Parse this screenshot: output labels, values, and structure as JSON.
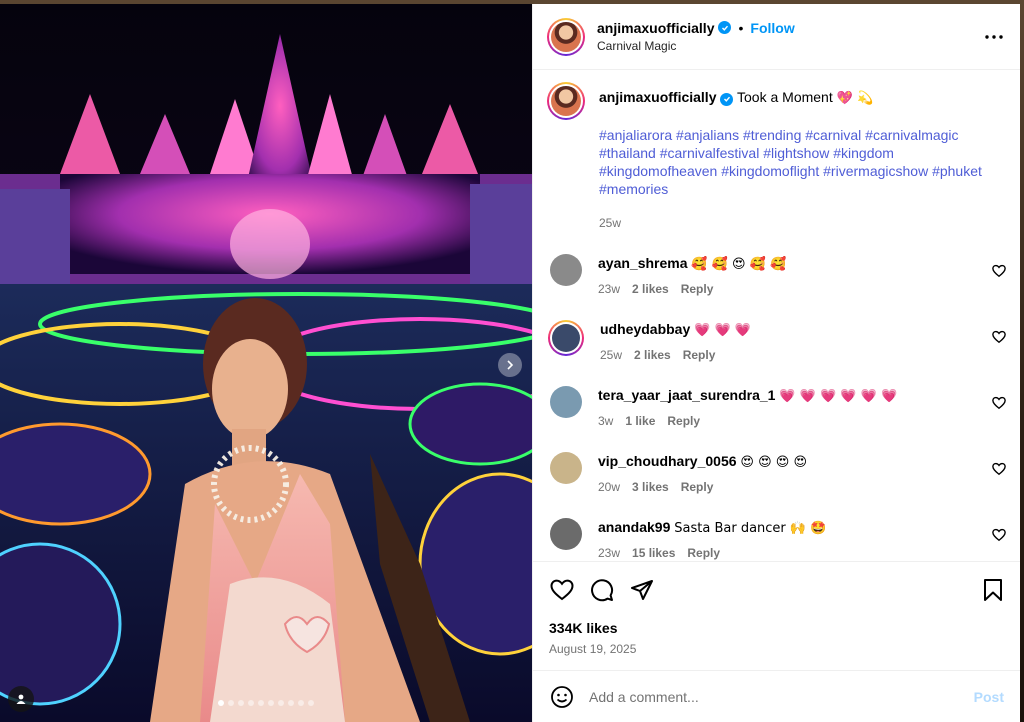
{
  "post": {
    "username": "anjimaxuofficially",
    "verified": true,
    "follow_label": "Follow",
    "separator": "•",
    "location": "Carnival Magic",
    "more_icon": "more-horizontal-icon"
  },
  "media": {
    "description_alt": "",
    "slide_count": 10,
    "active_slide": 1
  },
  "caption": {
    "username": "anjimaxuofficially",
    "text": "Took a Moment",
    "emojis": "💖 💫",
    "hashtags": "#anjaliarora #anjalians #trending #carnival #carnivalmagic #thailand #carnivalfestival #lightshow #kingdom #kingdomofheaven #kingdomoflight #rivermagicshow #phuket #memories",
    "time": "25w"
  },
  "comments": [
    {
      "username": "ayan_shrema",
      "text": "🥰 🥰 😍 🥰 🥰",
      "time": "23w",
      "likes": "2 likes",
      "reply": "Reply",
      "avatar_color": "#8a8a8a"
    },
    {
      "username": "udheydabbay",
      "text": "💗 💗 💗",
      "time": "25w",
      "likes": "2 likes",
      "reply": "Reply",
      "avatar_color": "#3a4a6a",
      "ring": true
    },
    {
      "username": "tera_yaar_jaat_surendra_1",
      "text": "💗 💗 💗 💗 💗 💗",
      "time": "3w",
      "likes": "1 like",
      "reply": "Reply",
      "avatar_color": "#7a9ab0"
    },
    {
      "username": "vip_choudhary_0056",
      "text": "😍 😍 😍 😍",
      "time": "20w",
      "likes": "3 likes",
      "reply": "Reply",
      "avatar_color": "#c9b48a"
    },
    {
      "username": "anandak99",
      "text": "Sasta Bar dancer 🙌 🤩",
      "time": "23w",
      "likes": "15 likes",
      "reply": "Reply",
      "avatar_color": "#6b6b6b"
    }
  ],
  "actions": {
    "like_icon": "heart-icon",
    "comment_icon": "comment-icon",
    "share_icon": "share-icon",
    "save_icon": "bookmark-icon"
  },
  "likes_count": "334K likes",
  "post_date": "August 19, 2025",
  "add_comment": {
    "placeholder": "Add a comment...",
    "post_label": "Post",
    "emoji_icon": "emoji-icon"
  },
  "colors": {
    "accent": "#0095f6",
    "hashtag": "#4f5dd6",
    "muted": "#737373",
    "post_disabled": "#b3dbff"
  }
}
